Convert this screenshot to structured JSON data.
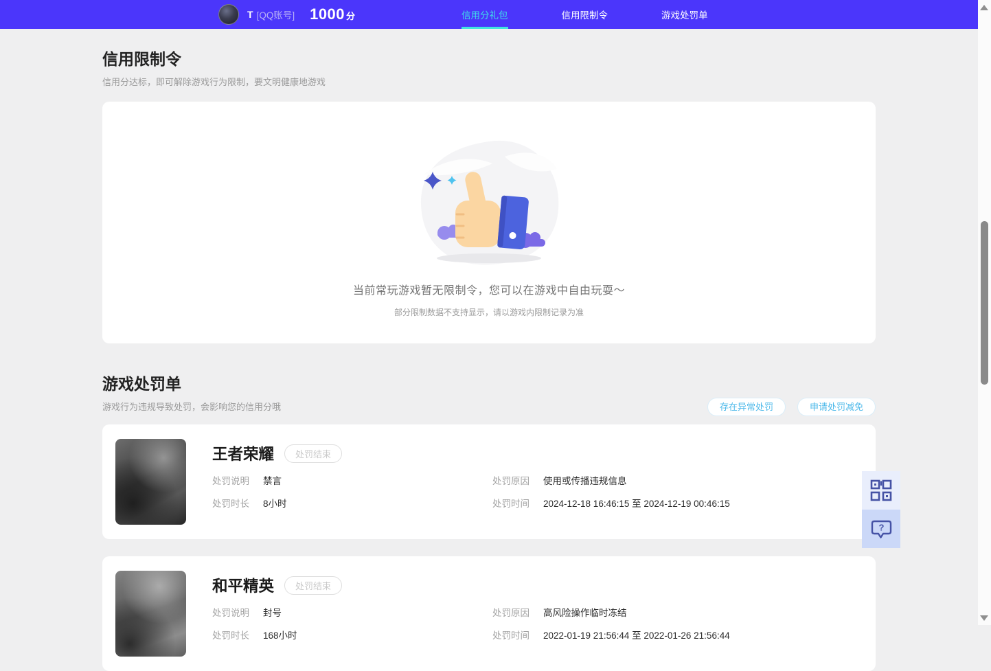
{
  "header": {
    "user": {
      "name": "T",
      "account_type": "[QQ账号]",
      "score": "1000",
      "score_unit": "分"
    },
    "tabs": [
      {
        "label": "信用分礼包",
        "active": true
      },
      {
        "label": "信用限制令",
        "active": false
      },
      {
        "label": "游戏处罚单",
        "active": false
      }
    ]
  },
  "restriction_section": {
    "title": "信用限制令",
    "subtitle": "信用分达标，即可解除游戏行为限制，要文明健康地游戏",
    "empty_state": {
      "illustration": "thumbs-up-illustration",
      "message": "当前常玩游戏暂无限制令，您可以在游戏中自由玩耍～",
      "note": "部分限制数据不支持显示，请以游戏内限制记录为准"
    }
  },
  "penalty_section": {
    "title": "游戏处罚单",
    "subtitle": "游戏行为违规导致处罚，会影响您的信用分哦",
    "actions": [
      {
        "label": "存在异常处罚"
      },
      {
        "label": "申请处罚减免"
      }
    ],
    "cards": [
      {
        "game": "王者荣耀",
        "status_badge": "处罚结束",
        "desc_label": "处罚说明",
        "desc_value": "禁言",
        "reason_label": "处罚原因",
        "reason_value": "使用或传播违规信息",
        "duration_label": "处罚时长",
        "duration_value": "8小时",
        "time_label": "处罚时间",
        "time_value": "2024-12-18 16:46:15 至 2024-12-19 00:46:15"
      },
      {
        "game": "和平精英",
        "status_badge": "处罚结束",
        "desc_label": "处罚说明",
        "desc_value": "封号",
        "reason_label": "处罚原因",
        "reason_value": "高风险操作临时冻结",
        "duration_label": "处罚时长",
        "duration_value": "168小时",
        "time_label": "处罚时间",
        "time_value": "2022-01-19 21:56:44 至 2022-01-26 21:56:44"
      }
    ]
  },
  "floating_widgets": {
    "qr_icon": "qr-code-icon",
    "help_icon": "help-bubble-icon",
    "help_glyph": "?"
  },
  "scrollbar": {
    "up_icon": "scroll-up-arrow",
    "down_icon": "scroll-down-arrow"
  },
  "colors": {
    "header_bg": "#4b36fb",
    "active_tab": "#3fdfe8",
    "page_bg": "#efeff0",
    "pill_text": "#4db9ea",
    "widget_icon": "#4552a5",
    "widget_bg_light": "#e9eefc",
    "widget_bg_dark": "#cbd8f8"
  }
}
